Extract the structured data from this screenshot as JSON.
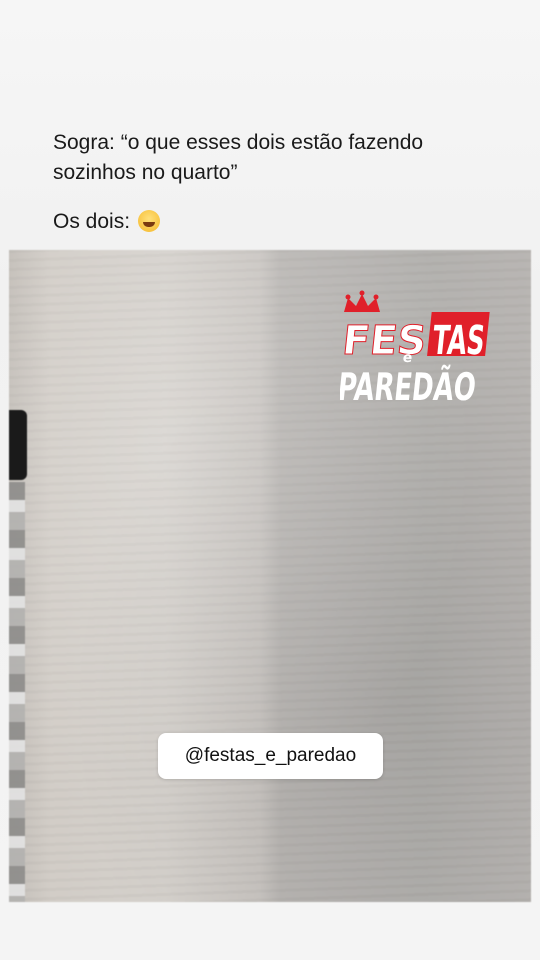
{
  "caption": {
    "line1": "Sogra: “o que esses dois estão fazendo sozinhos no quarto”",
    "line2": "Os dois:",
    "emoji": "laughing-tears-emoji"
  },
  "video": {
    "logo_line1": "FES",
    "logo_mid_small": "e",
    "logo_line1b": "TAS",
    "logo_line2": "PAREDÃO",
    "logo_color": "#e0202a",
    "logo_icon": "crown-icon"
  },
  "overlay": {
    "handle": "@festas_e_paredao"
  }
}
